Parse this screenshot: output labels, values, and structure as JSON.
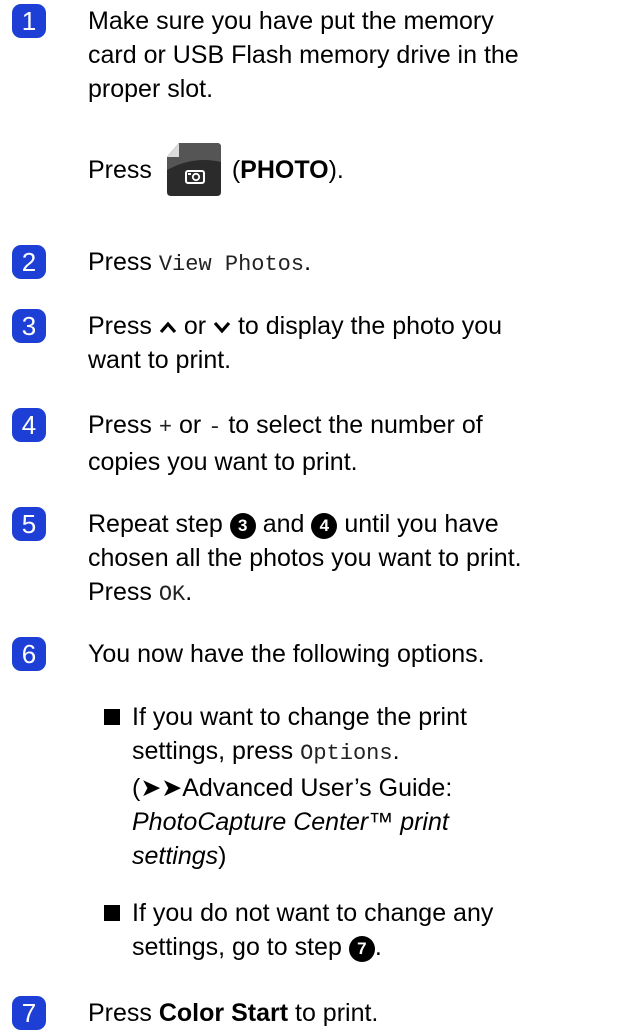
{
  "steps": [
    {
      "number": "1",
      "line1": "Make sure you have put the memory",
      "line2": "card or USB Flash memory drive in the",
      "line3": "proper slot.",
      "press_prefix": "Press",
      "photo_label": "PHOTO",
      "photo_open": "(",
      "photo_close": ")."
    },
    {
      "number": "2",
      "prefix": "Press",
      "mono": "View Photos",
      "suffix": "."
    },
    {
      "number": "3",
      "prefix": "Press",
      "or": "or",
      "line1_rest": "to display the photo you",
      "line2": "want to print."
    },
    {
      "number": "4",
      "prefix": "Press",
      "plus": "+",
      "or": "or",
      "minus": "-",
      "line1_rest": "to select the number of",
      "line2": "copies you want to print."
    },
    {
      "number": "5",
      "prefix": "Repeat step",
      "ref_a": "3",
      "and": "and",
      "ref_b": "4",
      "line1_rest": "until you have",
      "line2": "chosen all the photos you want to print.",
      "press": "Press",
      "ok": "OK",
      "ok_suffix": "."
    },
    {
      "number": "6",
      "text": "You now have the following options."
    },
    {
      "number": "7",
      "prefix": "Press",
      "bold": "Color Start",
      "suffix": "to print."
    }
  ],
  "bullets": [
    {
      "line1": "If you want to change the print",
      "line2_prefix": "settings, press",
      "line2_mono": "Options",
      "line2_suffix": ".",
      "line3": "(➤➤Advanced User’s Guide:",
      "line4_italic": "PhotoCapture Center™ print",
      "line5_italic": "settings",
      "line5_suffix": ")"
    },
    {
      "line1": "If you do not want to change any",
      "line2_prefix": "settings, go to step",
      "ref": "7",
      "line2_suffix": "."
    }
  ],
  "icons": {
    "photo_key": "camera-icon",
    "up": "chevron-up-icon",
    "down": "chevron-down-icon"
  },
  "colors": {
    "badge": "#1d3fd6",
    "photo_key_dark": "#2b2b2b"
  }
}
